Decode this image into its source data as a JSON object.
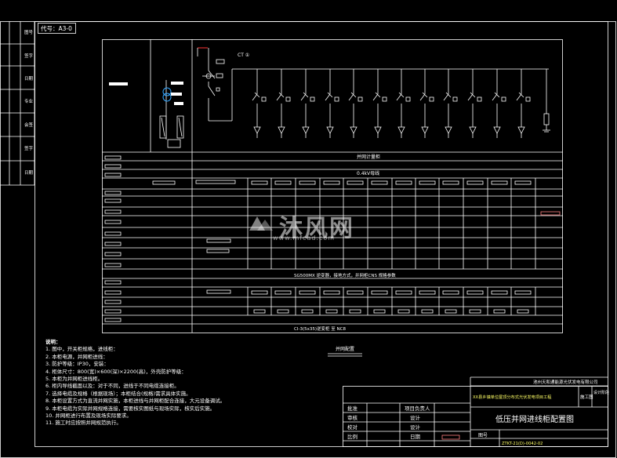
{
  "drawing_code": "代号：A3-0",
  "left_strip": [
    "图号",
    "签字",
    "日期",
    "专业",
    "会签",
    "签字",
    "日期"
  ],
  "top_note": "CT ①",
  "busbar_label": "0.4kV母线",
  "table_rows": {
    "plan": "并网计量柜",
    "inverter_note": "SG500MX 逆变器，接地方式，并网柜CNS 规格参数",
    "cable_note": "CI-3(5x35)逆变柜 至 NC8"
  },
  "notes_title": "说明：",
  "notes": [
    "1. 图中，开关柜规格，进线柜：",
    "2. 本柜电源，并网柜进线：",
    "3. 防护等级：IP30，安装：",
    "4. 柜体尺寸：800(宽)×600(深)×2200(高)，外壳防护等级：",
    "5. 本柜为并网柜进线柜。",
    "6. 柜内导线截面以及：对于不同，进线于不同电缆连接柜。",
    "7. 选择电缆及规格（根据现场）；本柜结合(规格)需求具体实施。",
    "8. 本柜设置方式为直流并网实施，本柜进线与并网柜配合连接，大元设备调试。",
    "9. 本柜电缆为实际并网规格连接，需要核实图纸与现场实际，核实后实施。",
    "10. 并网柜进行布置及现场实际要求。",
    "11. 施工时应按照并网规范执行。"
  ],
  "inner_label": "并网配置",
  "title_block": {
    "owner": "池州天和通能源光伏发电有限公司",
    "project": "XX县乡镇单位屋顶分布式光伏发电项目工程",
    "stage1": "施工图",
    "stage2": "设计阶段",
    "drawing_title": "低压并网进线柜配置图",
    "rows": [
      {
        "k1": "批准",
        "v1": "",
        "k2": "项目负责人",
        "v2": ""
      },
      {
        "k1": "审核",
        "v1": "",
        "k2": "设计",
        "v2": ""
      },
      {
        "k1": "校对",
        "v1": "",
        "k2": "设计",
        "v2": ""
      },
      {
        "k1": "比例",
        "v1": "",
        "k2": "日期",
        "v2": ""
      }
    ],
    "drawing_no_label": "图号",
    "drawing_no": "ZTKT-21(D)-0042-02"
  },
  "watermark": {
    "text": "沐风网",
    "url": "www.mfcad.com"
  }
}
